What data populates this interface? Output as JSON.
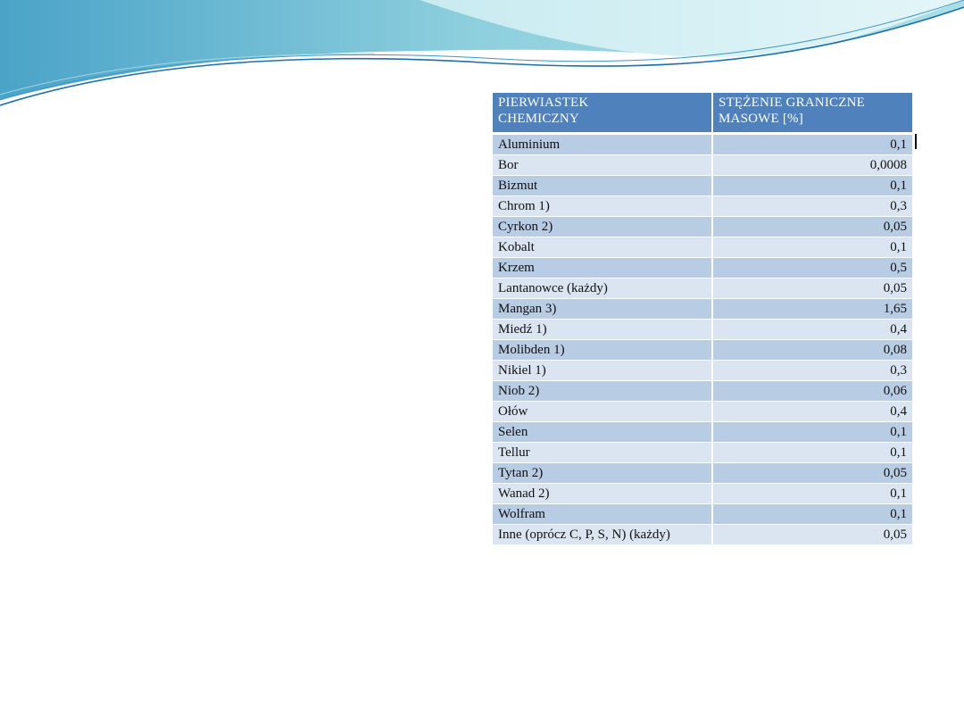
{
  "table": {
    "headers": [
      [
        "PIERWIASTEK",
        "CHEMICZNY"
      ],
      [
        "STĘŻENIE GRANICZNE",
        "MASOWE [%]"
      ]
    ],
    "rows": [
      [
        "Aluminium",
        "0,1"
      ],
      [
        "Bor",
        "0,0008"
      ],
      [
        "Bizmut",
        "0,1"
      ],
      [
        "Chrom 1)",
        "0,3"
      ],
      [
        "Cyrkon 2)",
        "0,05"
      ],
      [
        "Kobalt",
        "0,1"
      ],
      [
        "Krzem",
        "0,5"
      ],
      [
        "Lantanowce (każdy)",
        "0,05"
      ],
      [
        "Mangan 3)",
        "1,65"
      ],
      [
        "Miedź 1)",
        "0,4"
      ],
      [
        "Molibden 1)",
        "0,08"
      ],
      [
        "Nikiel 1)",
        "0,3"
      ],
      [
        "Niob 2)",
        "0,06"
      ],
      [
        "Ołów",
        "0,4"
      ],
      [
        "Selen",
        "0,1"
      ],
      [
        "Tellur",
        "0,1"
      ],
      [
        "Tytan 2)",
        "0,05"
      ],
      [
        "Wanad 2)",
        "0,1"
      ],
      [
        "Wolfram",
        "0,1"
      ],
      [
        "Inne (oprócz C, P, S,  N) (każdy)",
        "0,05"
      ]
    ]
  },
  "colors": {
    "header_bg": "#4f81bd",
    "row_dark": "#b8cce4",
    "row_light": "#dbe5f1",
    "wave_teal": "#6fc6d8",
    "wave_blue": "#1f6fa8"
  }
}
